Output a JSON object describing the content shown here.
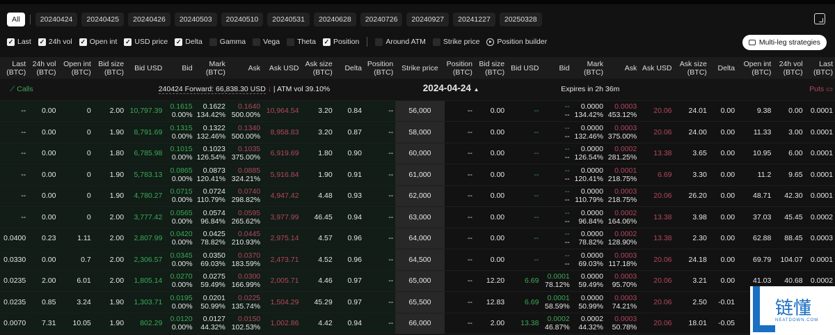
{
  "tabs": [
    "All",
    "20240424",
    "20240425",
    "20240426",
    "20240503",
    "20240510",
    "20240531",
    "20240628",
    "20240726",
    "20240927",
    "20241227",
    "20250328"
  ],
  "options": [
    {
      "label": "Last",
      "checked": true
    },
    {
      "label": "24h vol",
      "checked": true
    },
    {
      "label": "Open int",
      "checked": true
    },
    {
      "label": "USD price",
      "checked": true
    },
    {
      "label": "Delta",
      "checked": true
    },
    {
      "label": "Gamma",
      "checked": false
    },
    {
      "label": "Vega",
      "checked": false
    },
    {
      "label": "Theta",
      "checked": false
    },
    {
      "label": "Position",
      "checked": true
    }
  ],
  "options2": [
    {
      "label": "Around ATM",
      "checked": false
    },
    {
      "label": "Strike price",
      "checked": false
    }
  ],
  "position_builder": "Position builder",
  "multi_leg": "Multi-leg strategies",
  "headers_call": [
    "Last (BTC)",
    "24h vol (BTC)",
    "Open int (BTC)",
    "Bid size (BTC)",
    "Bid USD",
    "Bid",
    "Mark (BTC)",
    "Ask",
    "Ask USD",
    "Ask size (BTC)",
    "Delta",
    "Position (BTC)"
  ],
  "header_strike": "Strike price",
  "headers_put": [
    "Position (BTC)",
    "Bid size (BTC)",
    "Bid USD",
    "Bid",
    "Mark (BTC)",
    "Ask",
    "Ask USD",
    "Ask size (BTC)",
    "Delta",
    "Open int (BTC)",
    "24h vol (BTC)",
    "Last (BTC)"
  ],
  "info": {
    "calls": "Calls",
    "forward": "240424 Forward: 66,838.30 USD",
    "arrow": "↓",
    "atm": "| ATM vol 39.10%",
    "date": "2024-04-24",
    "expires": "Expires in 2h 36m",
    "puts": "Puts"
  },
  "colors": {
    "bid": "#3ea85a",
    "ask": "#b5475f",
    "call_bg": "#111d16"
  },
  "rows": [
    {
      "strike": "56,000",
      "call": [
        "--",
        "0.00",
        "0",
        "2.00",
        "10,797.39",
        "0.1615",
        "0.00%",
        "0.1622",
        "134.42%",
        "0.1640",
        "500.00%",
        "10,964.54",
        "3.20",
        "0.84",
        "--"
      ],
      "put": [
        "--",
        "0.00",
        "--",
        "--",
        "--",
        "0.0000",
        "134.42%",
        "0.0003",
        "453.12%",
        "20.06",
        "24.01",
        "0.00",
        "9.38",
        "0.00",
        "0.0001"
      ]
    },
    {
      "strike": "58,000",
      "call": [
        "--",
        "0.00",
        "0",
        "1.90",
        "8,791.69",
        "0.1315",
        "0.00%",
        "0.1322",
        "132.46%",
        "0.1340",
        "500.00%",
        "8,958.83",
        "3.20",
        "0.87",
        "--"
      ],
      "put": [
        "--",
        "0.00",
        "--",
        "--",
        "--",
        "0.0000",
        "132.46%",
        "0.0003",
        "375.00%",
        "20.06",
        "24.00",
        "0.00",
        "11.33",
        "3.00",
        "0.0001"
      ]
    },
    {
      "strike": "60,000",
      "call": [
        "--",
        "0.00",
        "0",
        "1.80",
        "6,785.98",
        "0.1015",
        "0.00%",
        "0.1023",
        "126.54%",
        "0.1035",
        "375.00%",
        "6,919.69",
        "1.80",
        "0.90",
        "--"
      ],
      "put": [
        "--",
        "0.00",
        "--",
        "--",
        "--",
        "0.0000",
        "126.54%",
        "0.0002",
        "281.25%",
        "13.38",
        "3.65",
        "0.00",
        "10.95",
        "6.00",
        "0.0001"
      ]
    },
    {
      "strike": "61,000",
      "call": [
        "--",
        "0.00",
        "0",
        "1.90",
        "5,783.13",
        "0.0865",
        "0.00%",
        "0.0873",
        "120.41%",
        "0.0885",
        "324.21%",
        "5,916.84",
        "1.90",
        "0.91",
        "--"
      ],
      "put": [
        "--",
        "0.00",
        "--",
        "--",
        "--",
        "0.0000",
        "120.41%",
        "0.0001",
        "218.75%",
        "6.69",
        "3.30",
        "0.00",
        "11.2",
        "9.65",
        "0.0001"
      ]
    },
    {
      "strike": "62,000",
      "call": [
        "--",
        "0.00",
        "0",
        "1.90",
        "4,780.27",
        "0.0715",
        "0.00%",
        "0.0724",
        "110.79%",
        "0.0740",
        "298.82%",
        "4,947.42",
        "4.48",
        "0.93",
        "--"
      ],
      "put": [
        "--",
        "0.00",
        "--",
        "--",
        "--",
        "0.0000",
        "110.79%",
        "0.0003",
        "218.75%",
        "20.06",
        "26.20",
        "0.00",
        "48.71",
        "42.30",
        "0.0001"
      ]
    },
    {
      "strike": "63,000",
      "call": [
        "--",
        "0.00",
        "0",
        "2.00",
        "3,777.42",
        "0.0565",
        "0.00%",
        "0.0574",
        "96.84%",
        "0.0595",
        "265.62%",
        "3,977.99",
        "46.45",
        "0.94",
        "--"
      ],
      "put": [
        "--",
        "0.00",
        "--",
        "--",
        "--",
        "0.0000",
        "96.84%",
        "0.0002",
        "164.06%",
        "13.38",
        "3.98",
        "0.00",
        "37.03",
        "45.45",
        "0.0002"
      ]
    },
    {
      "strike": "64,000",
      "call": [
        "0.0400",
        "0.23",
        "1.11",
        "2.00",
        "2,807.99",
        "0.0420",
        "0.00%",
        "0.0425",
        "78.82%",
        "0.0445",
        "210.93%",
        "2,975.14",
        "4.57",
        "0.96",
        "--"
      ],
      "put": [
        "--",
        "0.00",
        "--",
        "--",
        "--",
        "0.0000",
        "78.82%",
        "0.0002",
        "128.90%",
        "13.38",
        "2.30",
        "0.00",
        "62.88",
        "88.45",
        "0.0003"
      ]
    },
    {
      "strike": "64,500",
      "call": [
        "0.0330",
        "0.00",
        "0.7",
        "2.00",
        "2,306.57",
        "0.0345",
        "0.00%",
        "0.0350",
        "69.03%",
        "0.0370",
        "183.59%",
        "2,473.71",
        "4.52",
        "0.96",
        "--"
      ],
      "put": [
        "--",
        "0.00",
        "--",
        "--",
        "--",
        "0.0000",
        "69.03%",
        "0.0003",
        "117.18%",
        "20.06",
        "24.18",
        "0.00",
        "69.79",
        "104.07",
        "0.0001"
      ]
    },
    {
      "strike": "65,000",
      "call": [
        "0.0235",
        "2.00",
        "6.01",
        "2.00",
        "1,805.14",
        "0.0270",
        "0.00%",
        "0.0275",
        "59.49%",
        "0.0300",
        "166.99%",
        "2,005.71",
        "4.46",
        "0.97",
        "--"
      ],
      "put": [
        "--",
        "12.20",
        "6.69",
        "0.0001",
        "78.12%",
        "0.0000",
        "59.49%",
        "0.0003",
        "95.70%",
        "20.06",
        "3.21",
        "0.00",
        "41.03",
        "40.68",
        "0.0002"
      ]
    },
    {
      "strike": "65,500",
      "call": [
        "0.0235",
        "0.85",
        "3.24",
        "1.90",
        "1,303.71",
        "0.0195",
        "0.00%",
        "0.0201",
        "50.99%",
        "0.0225",
        "135.74%",
        "1,504.29",
        "45.29",
        "0.97",
        "--"
      ],
      "put": [
        "--",
        "12.83",
        "6.69",
        "0.0001",
        "58.59%",
        "0.0000",
        "50.99%",
        "0.0003",
        "74.21%",
        "20.06",
        "2.50",
        "-0.01",
        "",
        "",
        ""
      ]
    },
    {
      "strike": "66,000",
      "call": [
        "0.0070",
        "7.31",
        "10.05",
        "1.90",
        "802.29",
        "0.0120",
        "0.00%",
        "0.0127",
        "44.32%",
        "0.0150",
        "102.53%",
        "1,002.86",
        "4.42",
        "0.94",
        "--"
      ],
      "put": [
        "--",
        "2.00",
        "13.38",
        "0.0002",
        "46.87%",
        "0.0002",
        "44.32%",
        "0.0003",
        "50.78%",
        "20.06",
        "18.01",
        "-0.05",
        "",
        "",
        ""
      ]
    }
  ],
  "watermark": {
    "text": "链懂",
    "sub": "NEATDOWN.COM"
  }
}
